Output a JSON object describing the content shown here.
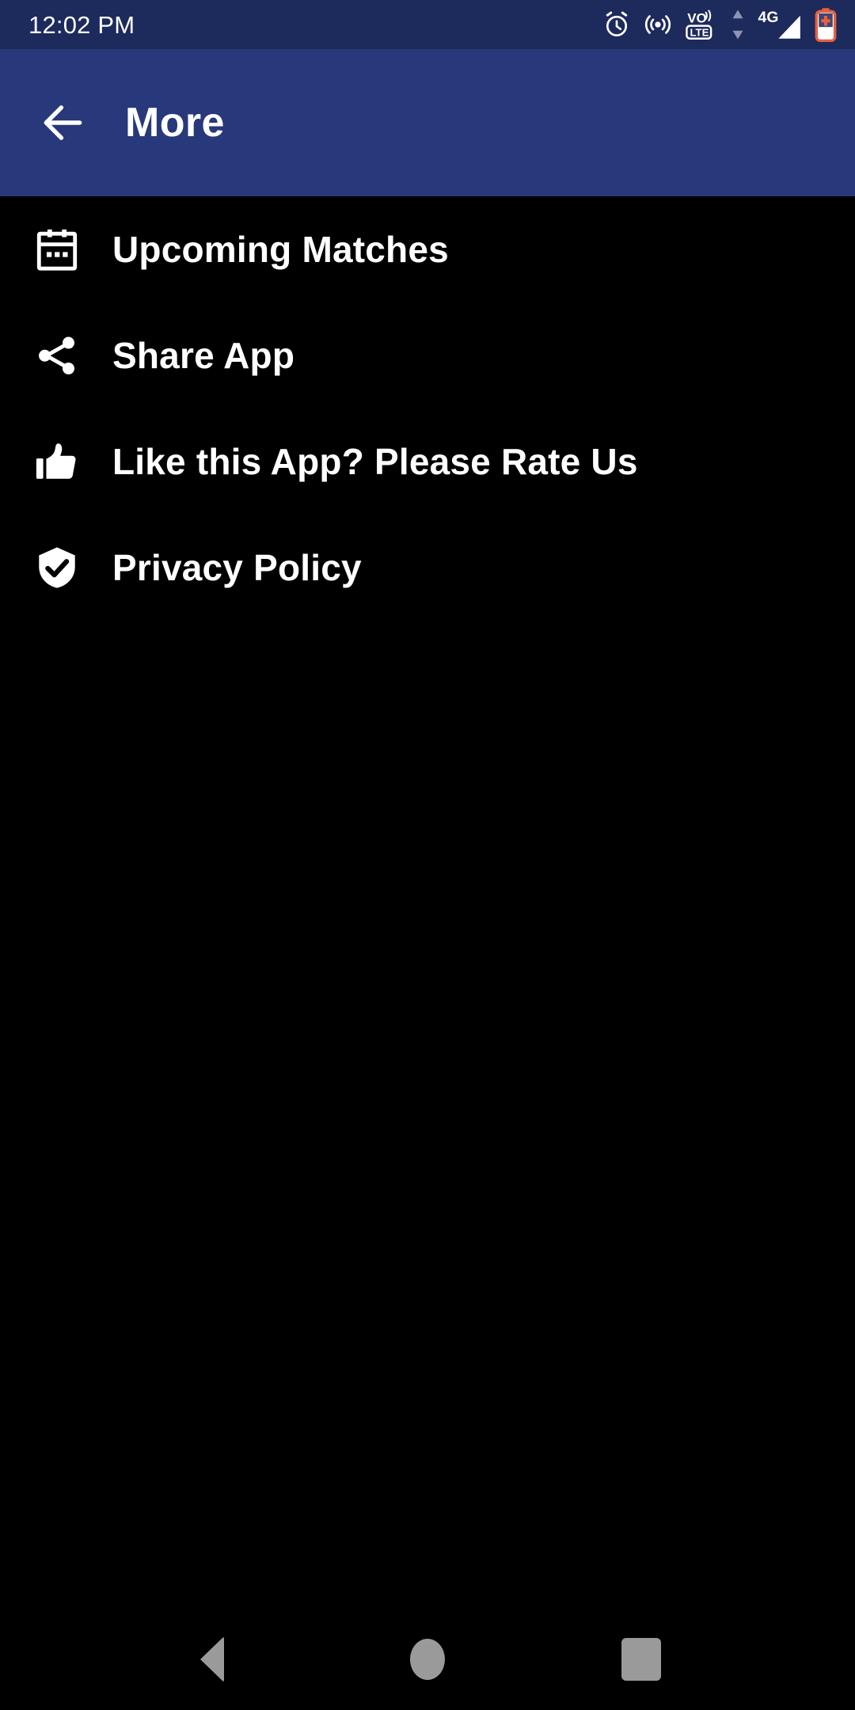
{
  "status_bar": {
    "time": "12:02 PM",
    "background_color": "#1d2a5c",
    "icons": [
      {
        "name": "alarm-icon",
        "label": "Alarm"
      },
      {
        "name": "hotspot-icon",
        "label": "Hotspot"
      },
      {
        "name": "volte-icon",
        "label": "VoLTE",
        "top_text": "VO",
        "bottom_text": "LTE"
      },
      {
        "name": "data-transfer-icon",
        "label": "Data transfer"
      },
      {
        "name": "signal-4g-icon",
        "label": "4G",
        "text": "4G"
      },
      {
        "name": "battery-charging-icon",
        "label": "Battery charging",
        "color": "#e8603c"
      }
    ]
  },
  "app_bar": {
    "title": "More",
    "back_label": "Back",
    "background_color": "#27397a"
  },
  "menu": {
    "items": [
      {
        "label": "Upcoming Matches",
        "icon": "calendar-icon"
      },
      {
        "label": "Share App",
        "icon": "share-icon"
      },
      {
        "label": "Like this App? Please Rate Us",
        "icon": "thumbs-up-icon"
      },
      {
        "label": "Privacy Policy",
        "icon": "shield-check-icon"
      }
    ]
  },
  "nav_bar": {
    "back_label": "Back",
    "home_label": "Home",
    "recents_label": "Recents",
    "icon_color": "#9a9a9a"
  }
}
